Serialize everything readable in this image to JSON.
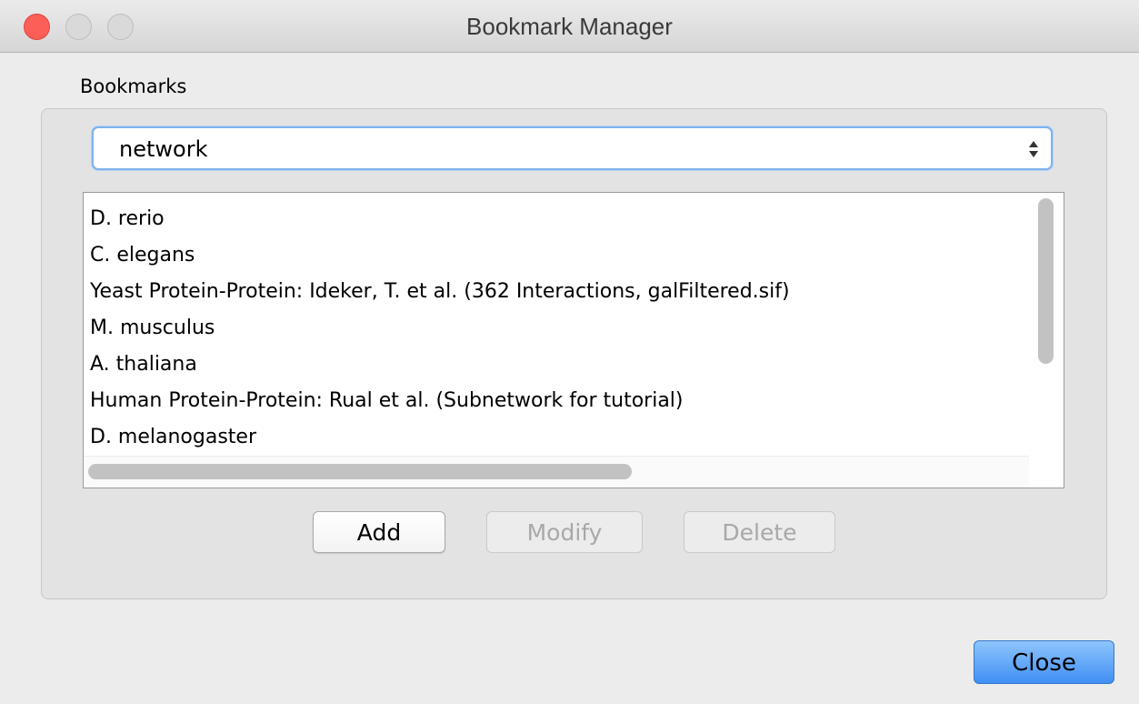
{
  "window": {
    "title": "Bookmark Manager",
    "controls": [
      "close-icon",
      "minimize-icon",
      "zoom-icon"
    ]
  },
  "bookmarks": {
    "label": "Bookmarks",
    "category_selected": "network",
    "items": [
      "D. rerio",
      "C. elegans",
      "Yeast Protein-Protein: Ideker, T. et al. (362 Interactions, galFiltered.sif)",
      "M. musculus",
      "A. thaliana",
      "Human Protein-Protein: Rual et al. (Subnetwork for tutorial)",
      "D. melanogaster"
    ],
    "buttons": {
      "add": "Add",
      "modify": "Modify",
      "delete": "Delete"
    }
  },
  "footer": {
    "close": "Close"
  },
  "colors": {
    "accent": "#3f8ff4",
    "close_traffic": "#fc5f57"
  }
}
